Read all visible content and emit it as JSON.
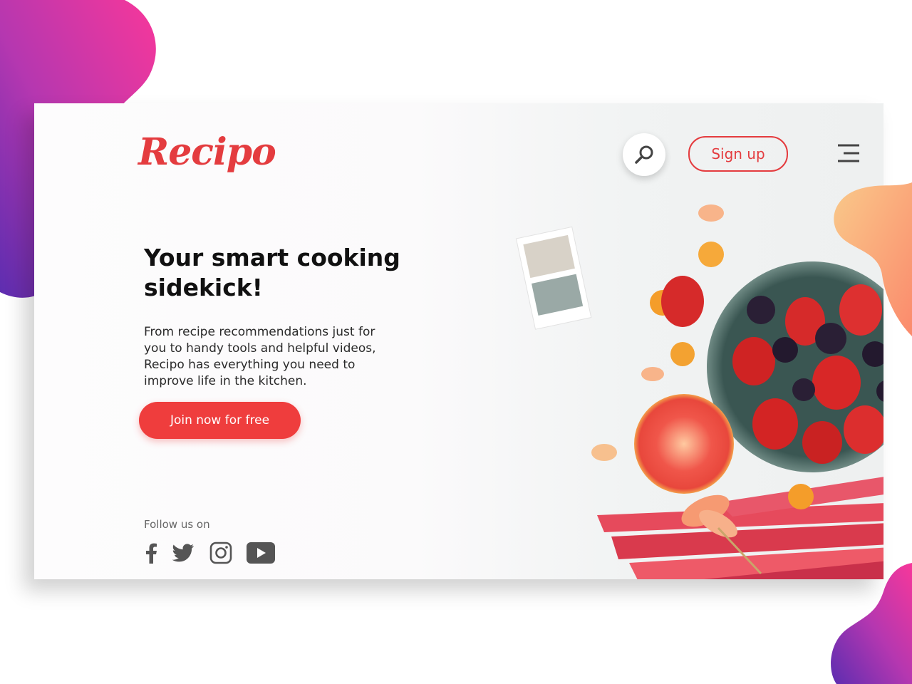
{
  "brand": {
    "name": "Recipo"
  },
  "header": {
    "search_icon": "search-icon",
    "signup_label": "Sign up",
    "menu_icon": "hamburger-menu-icon"
  },
  "hero": {
    "headline_line1": "Your smart cooking",
    "headline_line2": "sidekick!",
    "description_lines": [
      "From recipe recommendations just for",
      "you to handy tools and helpful videos,",
      "Recipo has everything you need to",
      "improve life in the kitchen."
    ],
    "cta_label": "Join now for free"
  },
  "footer": {
    "follow_label": "Follow us on",
    "social": [
      "facebook-icon",
      "twitter-icon",
      "instagram-icon",
      "youtube-icon"
    ]
  },
  "colors": {
    "accent": "#e43c3f",
    "cta": "#ef3d3d",
    "blob_gradient": [
      "#f7379a",
      "#5c2db0"
    ],
    "peach_gradient": [
      "#fba46a",
      "#f9c98a"
    ]
  }
}
